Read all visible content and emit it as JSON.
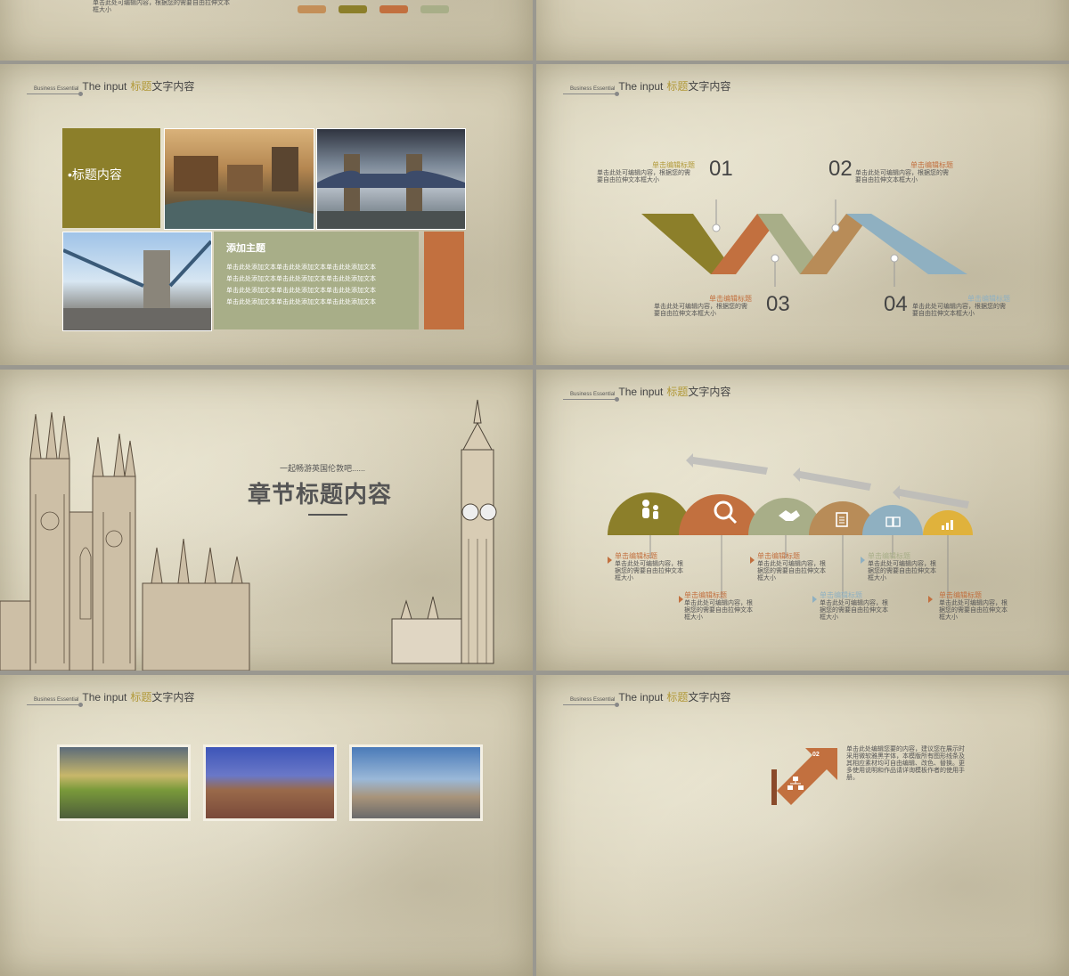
{
  "colors": {
    "olive": "#8c7f2a",
    "orange": "#c2703f",
    "sage": "#a8ae88",
    "blue": "#8fb0c1",
    "tan": "#b88c58",
    "gold": "#e0b23c"
  },
  "top_left": {
    "text_line1": "单击此处可编辑内容，根据您的需要自由拉伸文本",
    "text_line2": "框大小"
  },
  "header": {
    "business": "Business Essential",
    "title_en": "The input",
    "title_accent": "标题",
    "title_rest": "文字内容"
  },
  "slide1": {
    "block_label": "•标题内容",
    "panel_title": "添加主题",
    "panel_lines": [
      "单击此处添加文本单击此处添加文本单击此处添加文本",
      "单击此处添加文本单击此处添加文本单击此处添加文本",
      "单击此处添加文本单击此处添加文本单击此处添加文本",
      "单击此处添加文本单击此处添加文本单击此处添加文本"
    ]
  },
  "slide2": {
    "items": [
      {
        "num": "01",
        "title": "单击编辑标题",
        "text": "单击此处可编辑内容，根据您的需要自由拉伸文本框大小"
      },
      {
        "num": "02",
        "title": "单击编辑标题",
        "text": "单击此处可编辑内容，根据您的需要自由拉伸文本框大小"
      },
      {
        "num": "03",
        "title": "单击编辑标题",
        "text": "单击此处可编辑内容，根据您的需要自由拉伸文本框大小"
      },
      {
        "num": "04",
        "title": "单击编辑标题",
        "text": "单击此处可编辑内容，根据您的需要自由拉伸文本框大小"
      }
    ]
  },
  "slide3": {
    "subtitle": "一起畅游英国伦敦吧......",
    "title": "章节标题内容"
  },
  "slide4": {
    "items": [
      {
        "title": "单击编辑标题",
        "text": "单击此处可编辑内容，根据您的需要自由拉伸文本框大小",
        "icon": "people-icon"
      },
      {
        "title": "单击编辑标题",
        "text": "单击此处可编辑内容，根据您的需要自由拉伸文本框大小",
        "icon": "search-icon"
      },
      {
        "title": "单击编辑标题",
        "text": "单击此处可编辑内容，根据您的需要自由拉伸文本框大小",
        "icon": "handshake-icon"
      },
      {
        "title": "单击编辑标题",
        "text": "单击此处可编辑内容，根据您的需要自由拉伸文本框大小",
        "icon": "document-icon"
      },
      {
        "title": "单击编辑标题",
        "text": "单击此处可编辑内容，根据您的需要自由拉伸文本框大小",
        "icon": "puzzle-icon"
      },
      {
        "title": "单击编辑标题",
        "text": "单击此处可编辑内容，根据您的需要自由拉伸文本框大小",
        "icon": "chart-icon"
      }
    ]
  },
  "slide6": {
    "badge": "02",
    "text": "单击此处编辑您要的内容，建议您在展示时采用微软雅黑字体，本模版所有图形线条及其相应素材均可自由编辑、改色、替换。更多使用说明和作品请详询模板作者的使用手册。"
  }
}
